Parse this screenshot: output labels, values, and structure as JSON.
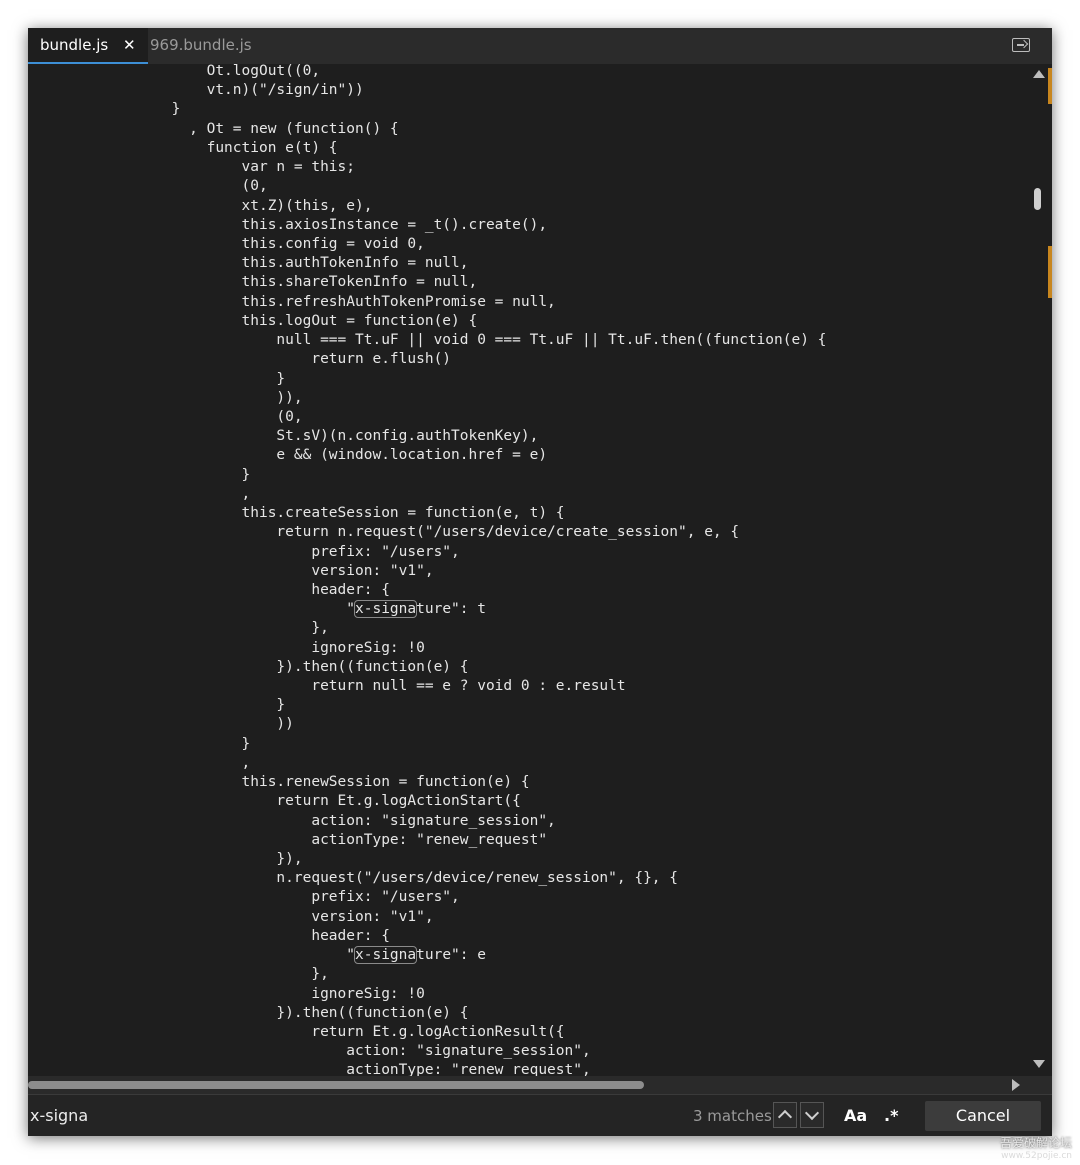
{
  "tabs": [
    {
      "label": "bundle.js",
      "active": true,
      "close_glyph": "✕"
    },
    {
      "label": "969.bundle.js",
      "active": false
    }
  ],
  "code_lines": [
    "                    Ot.logOut((0,",
    "                    vt.n)(\"/sign/in\"))",
    "                }",
    "                  , Ot = new (function() {",
    "                    function e(t) {",
    "                        var n = this;",
    "                        (0,",
    "                        xt.Z)(this, e),",
    "                        this.axiosInstance = _t().create(),",
    "                        this.config = void 0,",
    "                        this.authTokenInfo = null,",
    "                        this.shareTokenInfo = null,",
    "                        this.refreshAuthTokenPromise = null,",
    "                        this.logOut = function(e) {",
    "                            null === Tt.uF || void 0 === Tt.uF || Tt.uF.then((function(e) {",
    "                                return e.flush()",
    "                            }",
    "                            )),",
    "                            (0,",
    "                            St.sV)(n.config.authTokenKey),",
    "                            e && (window.location.href = e)",
    "                        }",
    "                        ,",
    "                        this.createSession = function(e, t) {",
    "                            return n.request(\"/users/device/create_session\", e, {",
    "                                prefix: \"/users\",",
    "                                version: \"v1\",",
    "                                header: {",
    "                                    \"x-signature\": t",
    "                                },",
    "                                ignoreSig: !0",
    "                            }).then((function(e) {",
    "                                return null == e ? void 0 : e.result",
    "                            }",
    "                            ))",
    "                        }",
    "                        ,",
    "                        this.renewSession = function(e) {",
    "                            return Et.g.logActionStart({",
    "                                action: \"signature_session\",",
    "                                actionType: \"renew_request\"",
    "                            }),",
    "                            n.request(\"/users/device/renew_session\", {}, {",
    "                                prefix: \"/users\",",
    "                                version: \"v1\",",
    "                                header: {",
    "                                    \"x-signature\": e",
    "                                },",
    "                                ignoreSig: !0",
    "                            }).then((function(e) {",
    "                                return Et.g.logActionResult({",
    "                                    action: \"signature_session\",",
    "                                    actionType: \"renew_request\","
  ],
  "search": {
    "query": "x-signa",
    "match_count": "3 matches",
    "case_label": "Aa",
    "regex_label": ".*",
    "cancel_label": "Cancel"
  },
  "watermark": {
    "text": "吾爱破解论坛",
    "url": "www.52pojie.cn"
  },
  "colors": {
    "background": "#1e1e1e",
    "tab_active_underline": "#3d8fd6",
    "scroll_marker": "#c8861e"
  }
}
